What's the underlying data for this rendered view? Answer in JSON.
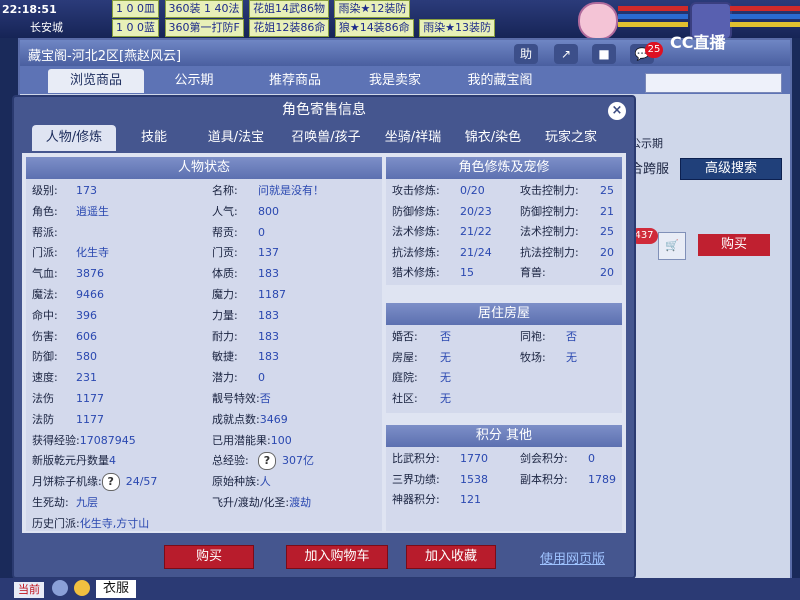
{
  "hud": {
    "clock": "22:18:51",
    "location": "长安城",
    "chat_row1": [
      "1 0 0皿",
      "360装 1 40法",
      "花姐14武86物",
      "雨染★12装防"
    ],
    "chat_row2": [
      "1 0 0蓝",
      "360第一打防F",
      "花姐12装86命",
      "狼★14装86命",
      "雨染★13装防"
    ]
  },
  "outer": {
    "title": "藏宝阁-河北2区[燕赵风云]",
    "tabs": [
      "浏览商品",
      "公示期",
      "推荐商品",
      "我是卖家",
      "我的藏宝阁"
    ],
    "toolbar": {
      "help": "助",
      "share": "↗",
      "stop": "■",
      "chat": "💬"
    },
    "badge": "25",
    "cc_logo": "CC直播",
    "side_publicity": "公示期",
    "side_cross": "合跨服",
    "adv_search": "高级搜索",
    "count": "437",
    "buy_side": "购买"
  },
  "dialog": {
    "title": "角色寄售信息",
    "tabs": [
      "人物/修炼",
      "技能",
      "道具/法宝",
      "召唤兽/孩子",
      "坐骑/祥瑞",
      "锦衣/染色",
      "玩家之家"
    ],
    "sections": {
      "status": "人物状态",
      "cultivation": "角色修炼及宠修",
      "house": "居住房屋",
      "points": "积分 其他"
    },
    "status_left": [
      {
        "label": "级别:",
        "value": "173"
      },
      {
        "label": "角色:",
        "value": "逍遥生"
      },
      {
        "label": "帮派:",
        "value": ""
      },
      {
        "label": "门派:",
        "value": "化生寺"
      },
      {
        "label": "气血:",
        "value": "3876"
      },
      {
        "label": "魔法:",
        "value": "9466"
      },
      {
        "label": "命中:",
        "value": "396"
      },
      {
        "label": "伤害:",
        "value": "606"
      },
      {
        "label": "防御:",
        "value": "580"
      },
      {
        "label": "速度:",
        "value": "231"
      },
      {
        "label": "法伤",
        "value": "1177"
      },
      {
        "label": "法防",
        "value": "1177"
      },
      {
        "label": "获得经验:",
        "value": "17087945"
      },
      {
        "label": "新版乾元丹数量",
        "value": "4"
      },
      {
        "label": "月饼粽子机缘:",
        "value": "24/57"
      },
      {
        "label": "生死劫:",
        "value": "九层"
      },
      {
        "label": "历史门派:",
        "value": "化生寺,方寸山"
      }
    ],
    "status_right": [
      {
        "label": "名称:",
        "value": "问就是没有！"
      },
      {
        "label": "人气:",
        "value": "800"
      },
      {
        "label": "帮贡:",
        "value": "0"
      },
      {
        "label": "门贡:",
        "value": "137"
      },
      {
        "label": "体质:",
        "value": "183"
      },
      {
        "label": "魔力:",
        "value": "1187"
      },
      {
        "label": "力量:",
        "value": "183"
      },
      {
        "label": "耐力:",
        "value": "183"
      },
      {
        "label": "敏捷:",
        "value": "183"
      },
      {
        "label": "潜力:",
        "value": "0"
      },
      {
        "label": "靓号特效:",
        "value": "否"
      },
      {
        "label": "成就点数:",
        "value": "3469"
      },
      {
        "label": "已用潜能果:",
        "value": "100"
      },
      {
        "label": "总经验:",
        "value": "307亿"
      },
      {
        "label": "原始种族:",
        "value": "人"
      },
      {
        "label": "飞升/渡劫/化圣:",
        "value": "渡劫"
      }
    ],
    "cultivation_left": [
      {
        "label": "攻击修炼:",
        "value": "0/20"
      },
      {
        "label": "防御修炼:",
        "value": "20/23"
      },
      {
        "label": "法术修炼:",
        "value": "21/22"
      },
      {
        "label": "抗法修炼:",
        "value": "21/24"
      },
      {
        "label": "猎术修炼:",
        "value": "15"
      }
    ],
    "cultivation_right": [
      {
        "label": "攻击控制力:",
        "value": "25"
      },
      {
        "label": "防御控制力:",
        "value": "21"
      },
      {
        "label": "法术控制力:",
        "value": "25"
      },
      {
        "label": "抗法控制力:",
        "value": "20"
      },
      {
        "label": "育兽:",
        "value": "20"
      }
    ],
    "house_left": [
      {
        "label": "婚否:",
        "value": "否"
      },
      {
        "label": "房屋:",
        "value": "无"
      },
      {
        "label": "庭院:",
        "value": "无"
      },
      {
        "label": "社区:",
        "value": "无"
      }
    ],
    "house_right": [
      {
        "label": "同袍:",
        "value": "否"
      },
      {
        "label": "牧场:",
        "value": "无"
      }
    ],
    "points_left": [
      {
        "label": "比武积分:",
        "value": "1770"
      },
      {
        "label": "三界功绩:",
        "value": "1538"
      },
      {
        "label": "神器积分:",
        "value": "121"
      }
    ],
    "points_right": [
      {
        "label": "剑会积分:",
        "value": "0"
      },
      {
        "label": "副本积分:",
        "value": "1789"
      }
    ],
    "buttons": {
      "buy": "购买",
      "add_cart": "加入购物车",
      "add_fav": "加入收藏",
      "web": "使用网页版"
    }
  },
  "bottom": {
    "current": "当前",
    "clothes": "衣服"
  },
  "colors": {
    "label": "#1a2340",
    "value": "#2a48b0",
    "buy": "#b81c2c",
    "header": "#5c70b0"
  }
}
